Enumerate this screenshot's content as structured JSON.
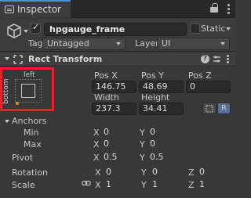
{
  "window": {
    "tab_label": "Inspector",
    "lock_icon": "lock-icon",
    "menu_icon": "kebab-menu-icon"
  },
  "gameobject": {
    "active": true,
    "name": "hpgauge_frame",
    "static_label": "Static",
    "static_checked": false,
    "tag_label": "Tag",
    "tag_value": "Untagged",
    "layer_label": "Layer",
    "layer_value": "UI"
  },
  "component": {
    "title": "Rect Transform",
    "help_icon": "?",
    "anchor_preset": {
      "top_label": "left",
      "side_label": "bottom",
      "highlight_color": "#e8202a"
    },
    "pos_x_label": "Pos X",
    "pos_y_label": "Pos Y",
    "pos_z_label": "Pos Z",
    "pos_x": "146.75",
    "pos_y": "48.69",
    "pos_z": "0",
    "width_label": "Width",
    "height_label": "Height",
    "width": "237.3",
    "height": "34.41",
    "raw_button": "R",
    "anchors_label": "Anchors",
    "min_label": "Min",
    "max_label": "Max",
    "min_x": "0",
    "min_y": "0",
    "max_x": "0",
    "max_y": "0",
    "pivot_label": "Pivot",
    "pivot_x": "0.5",
    "pivot_y": "0.5",
    "rotation_label": "Rotation",
    "rot_x": "0",
    "rot_y": "0",
    "rot_z": "0",
    "scale_label": "Scale",
    "scale_x": "1",
    "scale_y": "1",
    "scale_z": "1",
    "axis_x": "X",
    "axis_y": "Y",
    "axis_z": "Z"
  }
}
